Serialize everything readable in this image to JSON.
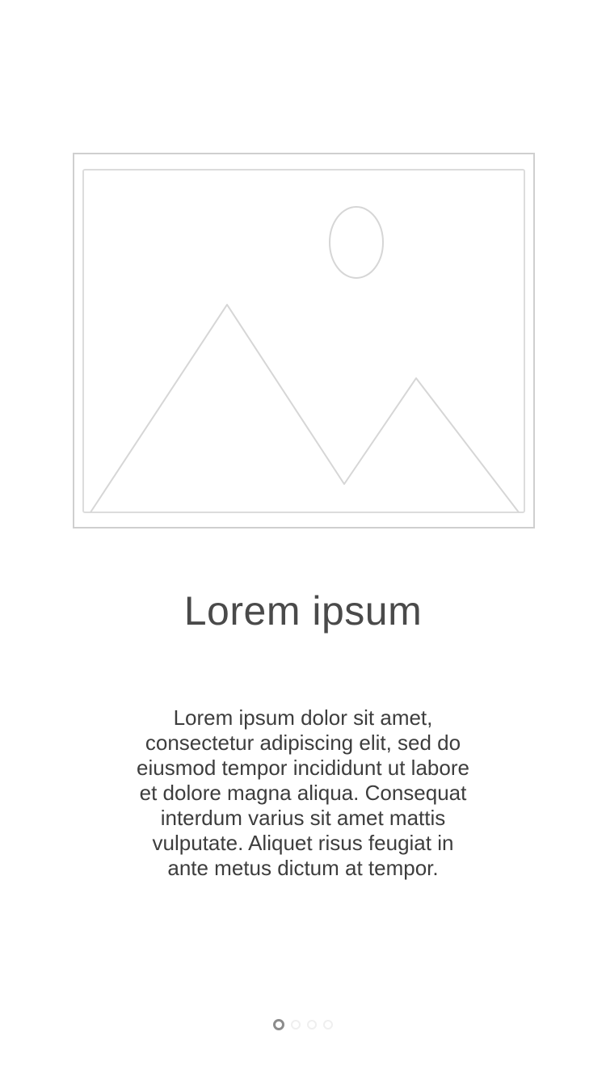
{
  "onboarding": {
    "image": {
      "icon": "image-placeholder-icon",
      "stroke_color": "#cfcfcf"
    },
    "title": "Lorem ipsum",
    "body": "Lorem ipsum dolor sit amet, consectetur adipiscing elit, sed do eiusmod tempor incididunt ut labore et dolore magna aliqua. Consequat interdum varius sit amet mattis vulputate. Aliquet risus feugiat in ante metus dictum at tempor.",
    "pager": {
      "total_pages": 4,
      "current_page": 1,
      "active_color": "#8c8c8c",
      "inactive_color": "#efefef"
    }
  }
}
